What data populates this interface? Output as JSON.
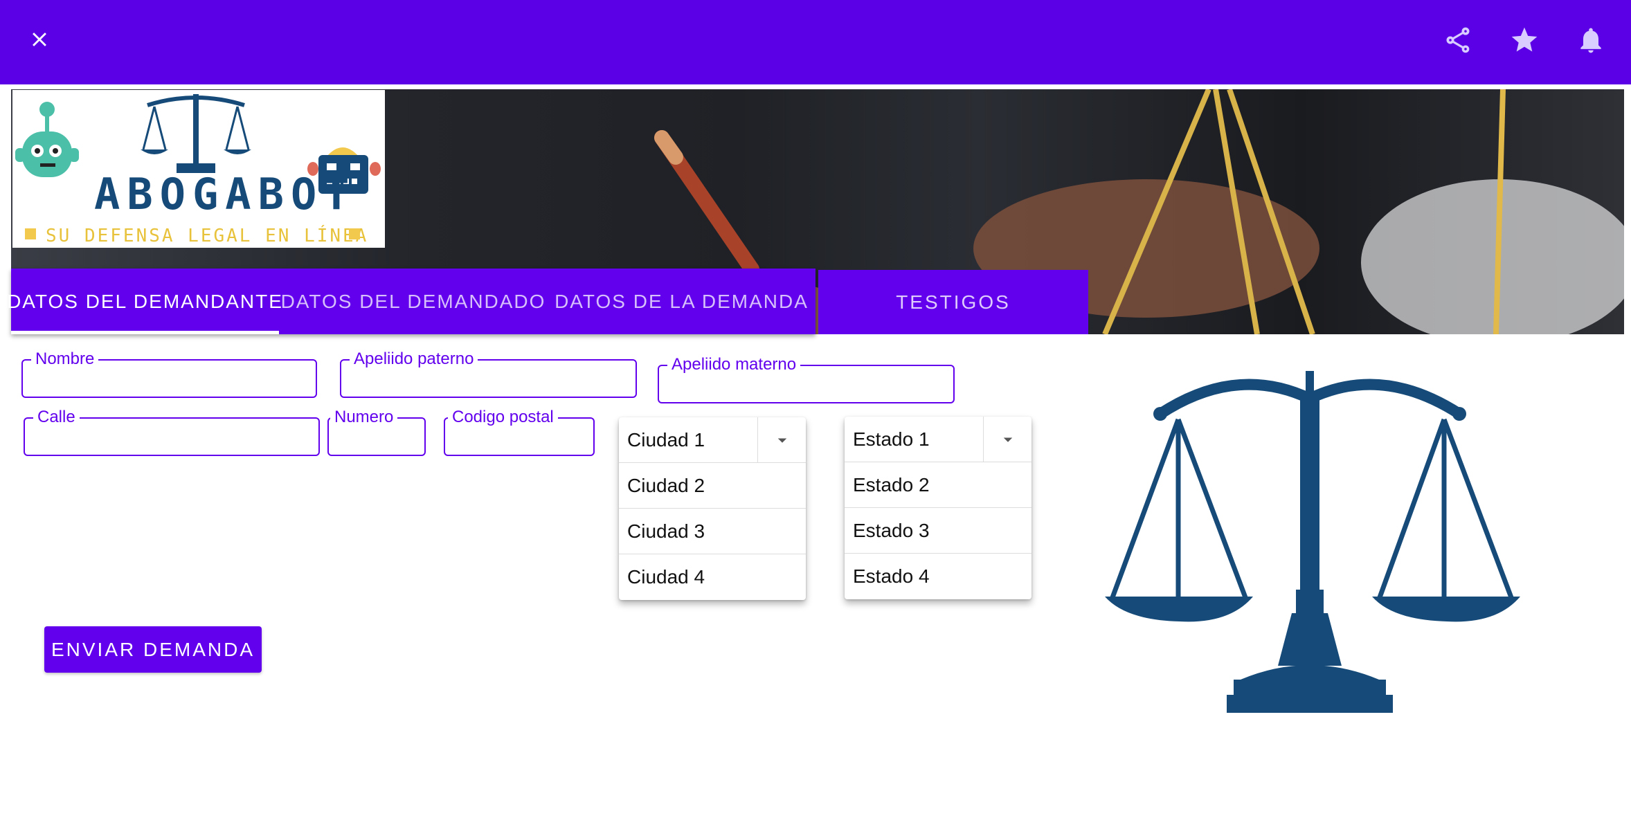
{
  "appbar": {
    "close_icon": "close-icon",
    "actions": [
      "share-icon",
      "star-icon",
      "bell-icon"
    ],
    "color": "#5b00e6"
  },
  "logo": {
    "title": "ABOGABOT",
    "subtitle": "SU DEFENSA LEGAL EN LÍNEA",
    "title_color": "#164b79",
    "subtitle_color": "#e8c23a"
  },
  "tabs": [
    {
      "label": "DATOS DEL DEMANDANTE",
      "active": true
    },
    {
      "label": "DATOS DEL DEMANDADO",
      "active": false
    },
    {
      "label": "DATOS DE LA DEMANDA",
      "active": false
    }
  ],
  "tab_testigos": "TESTIGOS",
  "form": {
    "nombre": {
      "label": "Nombre",
      "value": ""
    },
    "apellido_paterno": {
      "label": "Apeliido paterno",
      "value": ""
    },
    "apellido_materno": {
      "label": "Apeliido materno",
      "value": ""
    },
    "calle": {
      "label": "Calle",
      "value": ""
    },
    "numero": {
      "label": "Numero",
      "value": ""
    },
    "codigo_postal": {
      "label": "Codigo postal",
      "value": ""
    }
  },
  "ciudad": {
    "selected": "Ciudad 1",
    "options": [
      "Ciudad 2",
      "Ciudad 3",
      "Ciudad 4"
    ]
  },
  "estado": {
    "selected": "Estado 1",
    "options": [
      "Estado 2",
      "Estado 3",
      "Estado 4"
    ]
  },
  "submit_label": "ENVIAR DEMANDA",
  "accent_color": "#6200ee",
  "illustration_color": "#164b79"
}
